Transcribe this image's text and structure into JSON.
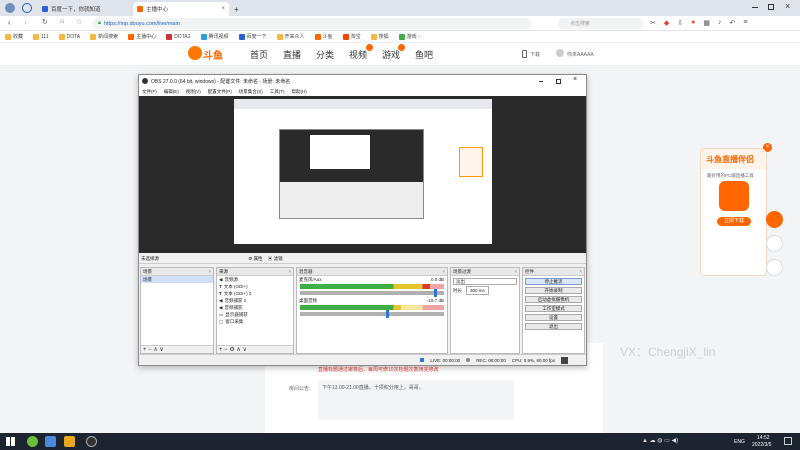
{
  "browser": {
    "tabs": [
      {
        "label": "百度一下，你就知道",
        "active": false
      },
      {
        "label": "主播中心",
        "active": true
      }
    ],
    "new_tab": "+",
    "url": "https://mp.douyu.com/live/main",
    "search_placeholder": "点击搜索",
    "bookmarks": [
      "收藏",
      "111",
      "DOTA",
      "新闻搜索",
      "主播中心",
      "DOTA2",
      "腾讯视频",
      "百度一下",
      "开来众人",
      "斗鱼",
      "淘宝",
      "搜狐",
      "游戏 -"
    ]
  },
  "site": {
    "logo": "斗鱼",
    "nav": [
      "首页",
      "直播",
      "分类",
      "视频",
      "游戏",
      "鱼吧"
    ],
    "download": "下载",
    "user": "你未AAAAA"
  },
  "obs": {
    "title": "OBS 27.0.0 (64 bit, windows) - 配置文件: 未命名 - 场景: 未命名",
    "menu": [
      "文件(F)",
      "编辑(E)",
      "视图(V)",
      "配置文件(P)",
      "场景集合(S)",
      "工具(T)",
      "帮助(H)"
    ],
    "source_bar": "未选择源",
    "source_props": "属性",
    "source_filters": "滤镜",
    "scenes_title": "场景",
    "scenes": [
      "场景"
    ],
    "sources_title": "来源",
    "sources": [
      "音频源",
      "文本 (GDI+)",
      "文本 (GDI+) 2",
      "音频捕获 2",
      "音频捕获",
      "显示器捕获",
      "窗口采集"
    ],
    "mixer_title": "混音器",
    "mixer": [
      {
        "name": "麦克风/Aux",
        "db": "0.0 dB",
        "level": 0.93
      },
      {
        "name": "桌面音频",
        "db": "-15.7 dB",
        "level": 0.6
      }
    ],
    "transitions_title": "场景过渡",
    "transition_value": "淡出",
    "duration_label": "时长",
    "duration_value": "300 ms",
    "controls_title": "控件",
    "controls": [
      "停止推流",
      "开始录制",
      "启动虚拟摄像机",
      "工作室模式",
      "设置",
      "退出"
    ],
    "status": [
      "LIVE: 00:00:00",
      "REC: 00:00:00",
      "CPU: 0.9%, 60.00 fps"
    ]
  },
  "page": {
    "notice": "直播标题通过审核后，每周可修10次标题次数用完修改",
    "notice_label": "房间公告:",
    "notice_text": "下午13.00-21.00直播。十项积分用上，哥哥。",
    "ad_title": "斗鱼直播伴侣",
    "ad_sub": "最好用的PC端直播工具",
    "ad_btn": "立即下载",
    "watermark": "VX：ChengjiX_lin"
  },
  "taskbar": {
    "time": "14:52",
    "date": "2022/3/5",
    "lang": "ENG"
  }
}
